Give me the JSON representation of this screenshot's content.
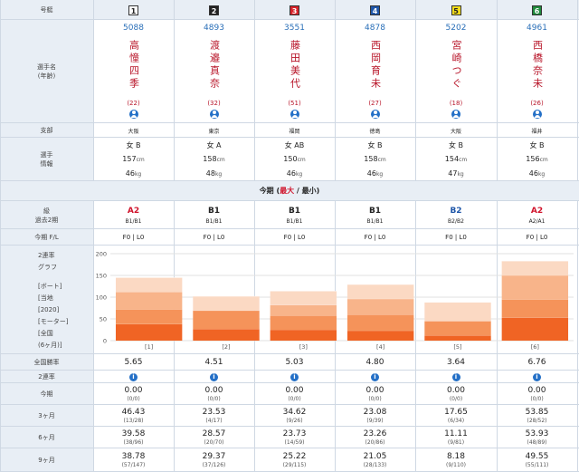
{
  "labels": {
    "lane": "号艇",
    "name": "選手名\n(年齢)",
    "branch": "支部",
    "info": "選手\n情報",
    "grade": "級\n過去2期",
    "fl": "今期 F/L",
    "graph": "2連率\nグラフ",
    "legend": [
      "[ボート]",
      "[当地",
      "[2020]",
      "[モーター]",
      "[全国",
      "(6ヶ月)]"
    ],
    "overall": "全国勝率",
    "rate2": "2連率",
    "today": "今期",
    "m3": "3ヶ月",
    "m6": "6ヶ月",
    "m9": "9ヶ月"
  },
  "section_title": {
    "pre": "今期 (",
    "max": "最大",
    "sep": " / ",
    "min": "最小",
    "post": ")"
  },
  "racers": [
    {
      "lane": "1",
      "lane_bg": "#ffffff",
      "lane_fg": "#222222",
      "id": "5088",
      "name": "高憧四季",
      "age": "(22)",
      "branch": "大阪",
      "sex_class": "女 B",
      "height": "157",
      "weight": "46",
      "grade": "A2",
      "grade_color": "#d0142c",
      "past": "B1/B1",
      "fl": "F0 | L0",
      "overall": "5.65",
      "today": "0.00",
      "today_s": "(0/0)",
      "m3": "46.43",
      "m3_s": "(13/28)",
      "m6": "39.58",
      "m6_s": "(38/96)",
      "m9": "38.78",
      "m9_s": "(57/147)"
    },
    {
      "lane": "2",
      "lane_bg": "#222222",
      "lane_fg": "#ffffff",
      "id": "4893",
      "name": "渡邉真奈",
      "age": "(32)",
      "branch": "東京",
      "sex_class": "女 A",
      "height": "158",
      "weight": "48",
      "grade": "B1",
      "grade_color": "#222222",
      "past": "B1/B1",
      "fl": "F0 | L0",
      "overall": "4.51",
      "today": "0.00",
      "today_s": "(0/0)",
      "m3": "23.53",
      "m3_s": "(4/17)",
      "m6": "28.57",
      "m6_s": "(20/70)",
      "m9": "29.37",
      "m9_s": "(37/126)"
    },
    {
      "lane": "3",
      "lane_bg": "#d8232a",
      "lane_fg": "#ffffff",
      "id": "3551",
      "name": "藤田美代",
      "age": "(51)",
      "branch": "福岡",
      "sex_class": "女 AB",
      "height": "150",
      "weight": "46",
      "grade": "B1",
      "grade_color": "#222222",
      "past": "B1/B1",
      "fl": "F0 | L0",
      "overall": "5.03",
      "today": "0.00",
      "today_s": "(0/0)",
      "m3": "34.62",
      "m3_s": "(9/26)",
      "m6": "23.73",
      "m6_s": "(14/59)",
      "m9": "25.22",
      "m9_s": "(29/115)"
    },
    {
      "lane": "4",
      "lane_bg": "#1f56a8",
      "lane_fg": "#ffffff",
      "id": "4878",
      "name": "西岡育未",
      "age": "(27)",
      "branch": "徳島",
      "sex_class": "女 B",
      "height": "158",
      "weight": "46",
      "grade": "B1",
      "grade_color": "#222222",
      "past": "B1/B1",
      "fl": "F0 | L0",
      "overall": "4.80",
      "today": "0.00",
      "today_s": "(0/0)",
      "m3": "23.08",
      "m3_s": "(9/39)",
      "m6": "23.26",
      "m6_s": "(20/86)",
      "m9": "21.05",
      "m9_s": "(28/133)"
    },
    {
      "lane": "5",
      "lane_bg": "#f3dd1c",
      "lane_fg": "#222222",
      "id": "5202",
      "name": "宮崎つぐ",
      "age": "(18)",
      "branch": "大阪",
      "sex_class": "女 B",
      "height": "154",
      "weight": "47",
      "grade": "B2",
      "grade_color": "#1f56a8",
      "past": "B2/B2",
      "fl": "F0 | L0",
      "overall": "3.64",
      "today": "0.00",
      "today_s": "(0/0)",
      "m3": "17.65",
      "m3_s": "(6/34)",
      "m6": "11.11",
      "m6_s": "(9/81)",
      "m9": "8.18",
      "m9_s": "(9/110)"
    },
    {
      "lane": "6",
      "lane_bg": "#1f8a3c",
      "lane_fg": "#ffffff",
      "id": "4961",
      "name": "西橋奈未",
      "age": "(26)",
      "branch": "福井",
      "sex_class": "女 B",
      "height": "156",
      "weight": "46",
      "grade": "A2",
      "grade_color": "#d0142c",
      "past": "A2/A1",
      "fl": "F0 | L0",
      "overall": "6.76",
      "today": "0.00",
      "today_s": "(0/0)",
      "m3": "53.85",
      "m3_s": "(28/52)",
      "m6": "53.93",
      "m6_s": "(48/89)",
      "m9": "49.55",
      "m9_s": "(55/111)"
    }
  ],
  "chart_data": {
    "type": "bar",
    "stacked": true,
    "categories": [
      "[1]",
      "[2]",
      "[3]",
      "[4]",
      "[5]",
      "[6]"
    ],
    "ylim": [
      0,
      200
    ],
    "yticks": [
      0,
      50,
      100,
      150,
      200
    ],
    "grid": true,
    "series": [
      {
        "values": [
          38,
          27,
          25,
          23,
          12,
          53
        ],
        "color": "#f06424"
      },
      {
        "values": [
          34,
          42,
          33,
          37,
          33,
          42
        ],
        "color": "#f5935a"
      },
      {
        "values": [
          40,
          0,
          24,
          36,
          0,
          55
        ],
        "color": "#f8b48a"
      },
      {
        "values": [
          33,
          33,
          32,
          33,
          43,
          33
        ],
        "color": "#fbd9c3"
      }
    ]
  },
  "units": {
    "cm": "cm",
    "kg": "kg"
  }
}
